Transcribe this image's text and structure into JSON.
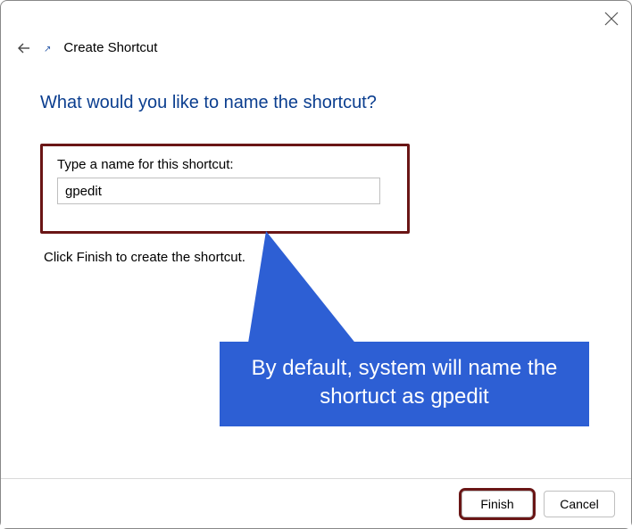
{
  "window": {
    "title": "Create Shortcut"
  },
  "main": {
    "question": "What would you like to name the shortcut?",
    "field_label": "Type a name for this shortcut:",
    "input_value": "gpedit",
    "hint": "Click Finish to create the shortcut."
  },
  "callout": {
    "text": "By default, system will name the shortuct as gpedit"
  },
  "footer": {
    "finish_label": "Finish",
    "cancel_label": "Cancel"
  }
}
